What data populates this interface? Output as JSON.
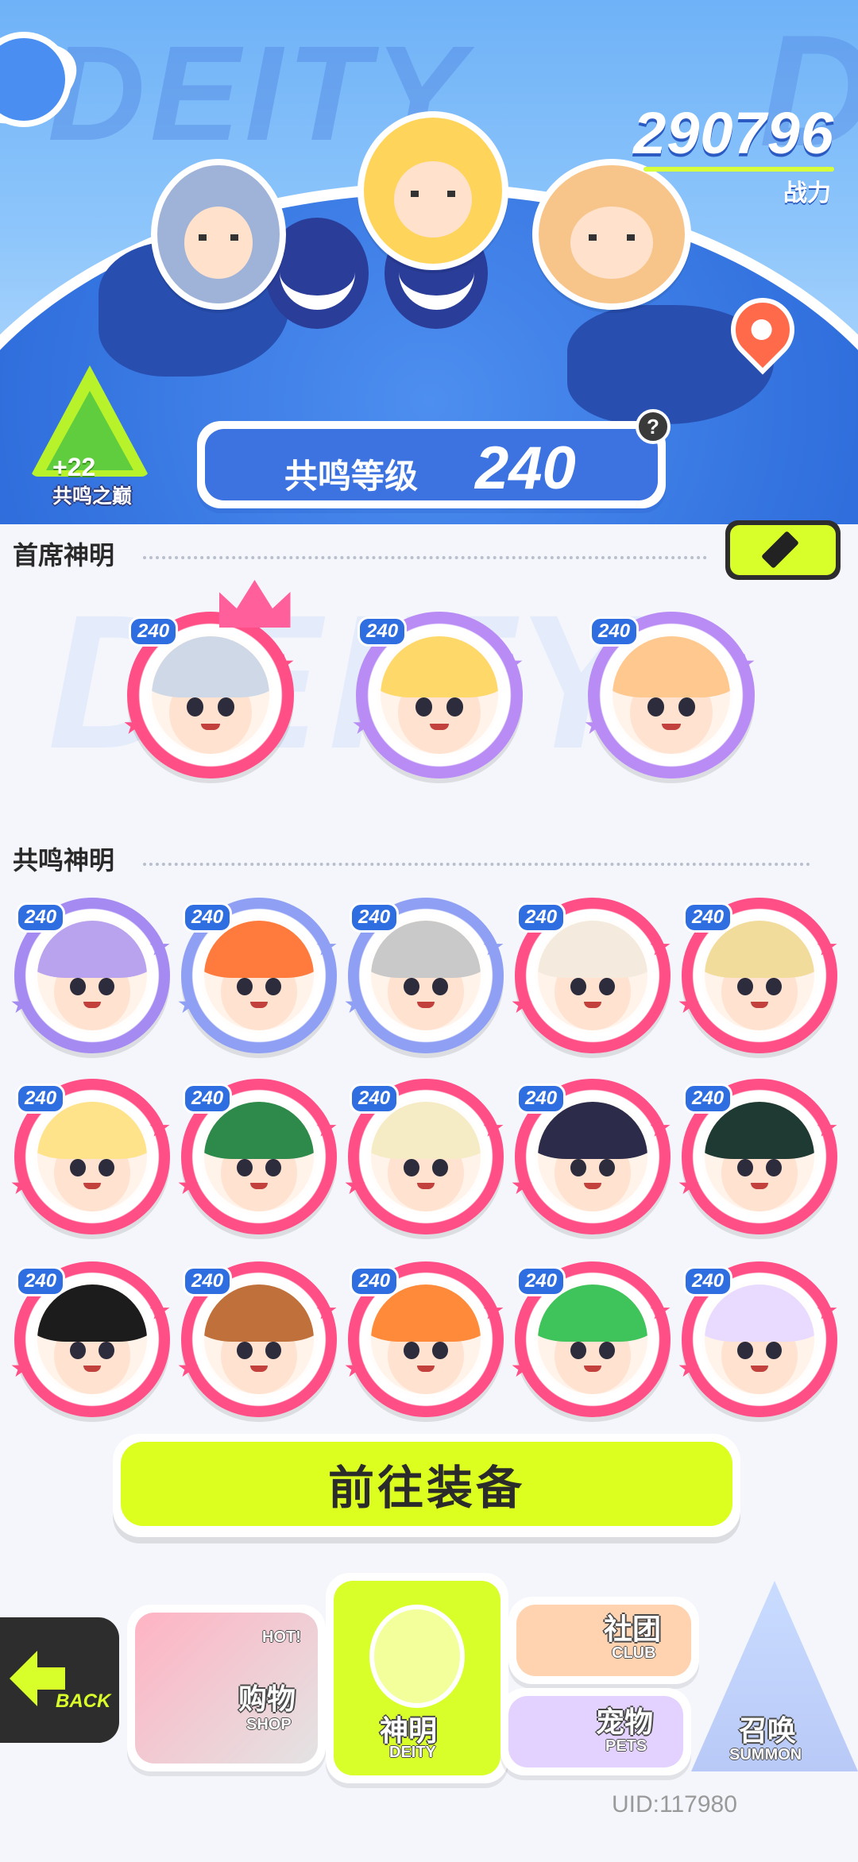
{
  "hero": {
    "bg_word": "DEITY",
    "bg_letter": "D",
    "power_value": "290796",
    "power_label": "战力"
  },
  "peak": {
    "bonus": "+22",
    "name": "共鸣之巅"
  },
  "resonance": {
    "label": "共鸣等级",
    "value": "240",
    "help": "?"
  },
  "sections": {
    "head_deities": "首席神明",
    "resonant_deities": "共鸣神明"
  },
  "bg_deity": "DEITY",
  "head_deities": [
    {
      "level": "240",
      "ring": "#ff4f86",
      "hair": "#cfd8e6",
      "crown": true
    },
    {
      "level": "240",
      "ring": "#b98cf5",
      "hair": "#ffd86a",
      "crown": false
    },
    {
      "level": "240",
      "ring": "#b98cf5",
      "hair": "#ffc88e",
      "crown": false
    }
  ],
  "resonant_deities": [
    {
      "level": "240",
      "ring": "#a58af2",
      "hair": "#b9a3ef"
    },
    {
      "level": "240",
      "ring": "#8fa0f4",
      "hair": "#ff7a3d"
    },
    {
      "level": "240",
      "ring": "#8fa0f4",
      "hair": "#c9c9c9"
    },
    {
      "level": "240",
      "ring": "#ff4f86",
      "hair": "#f4eadd"
    },
    {
      "level": "240",
      "ring": "#ff4f86",
      "hair": "#f2dc9c"
    },
    {
      "level": "240",
      "ring": "#ff4f86",
      "hair": "#ffe38a"
    },
    {
      "level": "240",
      "ring": "#ff4f86",
      "hair": "#2d8a4a"
    },
    {
      "level": "240",
      "ring": "#ff4f86",
      "hair": "#f5ecc5"
    },
    {
      "level": "240",
      "ring": "#ff4f86",
      "hair": "#2c2c4a"
    },
    {
      "level": "240",
      "ring": "#ff4f86",
      "hair": "#1f3a33"
    },
    {
      "level": "240",
      "ring": "#ff4f86",
      "hair": "#1c1c1c"
    },
    {
      "level": "240",
      "ring": "#ff4f86",
      "hair": "#c0703a"
    },
    {
      "level": "240",
      "ring": "#ff4f86",
      "hair": "#ff8a3a"
    },
    {
      "level": "240",
      "ring": "#ff4f86",
      "hair": "#3fc45b"
    },
    {
      "level": "240",
      "ring": "#ff4f86",
      "hair": "#e9dbff"
    }
  ],
  "equip_button": "前往装备",
  "nav": {
    "back": "BACK",
    "shop_cn": "购物",
    "shop_en": "SHOP",
    "hot": "HOT!",
    "deity_cn": "神明",
    "deity_en": "DEITY",
    "club_cn": "社团",
    "club_en": "CLUB",
    "pets_cn": "宠物",
    "pets_en": "PETS",
    "summon_cn": "召唤",
    "summon_en": "SUMMON"
  },
  "uid": "UID:117980",
  "colors": {
    "accent_yellow": "#dcff20",
    "primary_blue": "#3d73e0",
    "pink_ring": "#ff4f86"
  }
}
